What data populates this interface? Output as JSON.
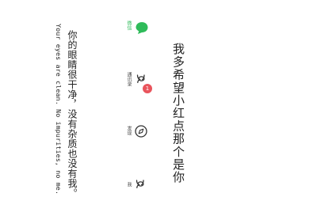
{
  "headline": "我多希望小红点那个是你",
  "quote": {
    "chinese": "你的眼睛很干净，没有杂质也没有我。",
    "english": "Your eyes are clean. No impurities, no me."
  },
  "tabs": [
    {
      "label": "微信",
      "icon": "chat-bubble-icon",
      "active": true
    },
    {
      "label": "通讯录",
      "icon": "contacts-icon",
      "active": false,
      "badge": "1"
    },
    {
      "label": "发现",
      "icon": "compass-icon",
      "active": false
    },
    {
      "label": "我",
      "icon": "person-icon",
      "active": false
    }
  ],
  "colors": {
    "accent": "#2fbb5a",
    "badge": "#e9545c",
    "text": "#222222"
  }
}
